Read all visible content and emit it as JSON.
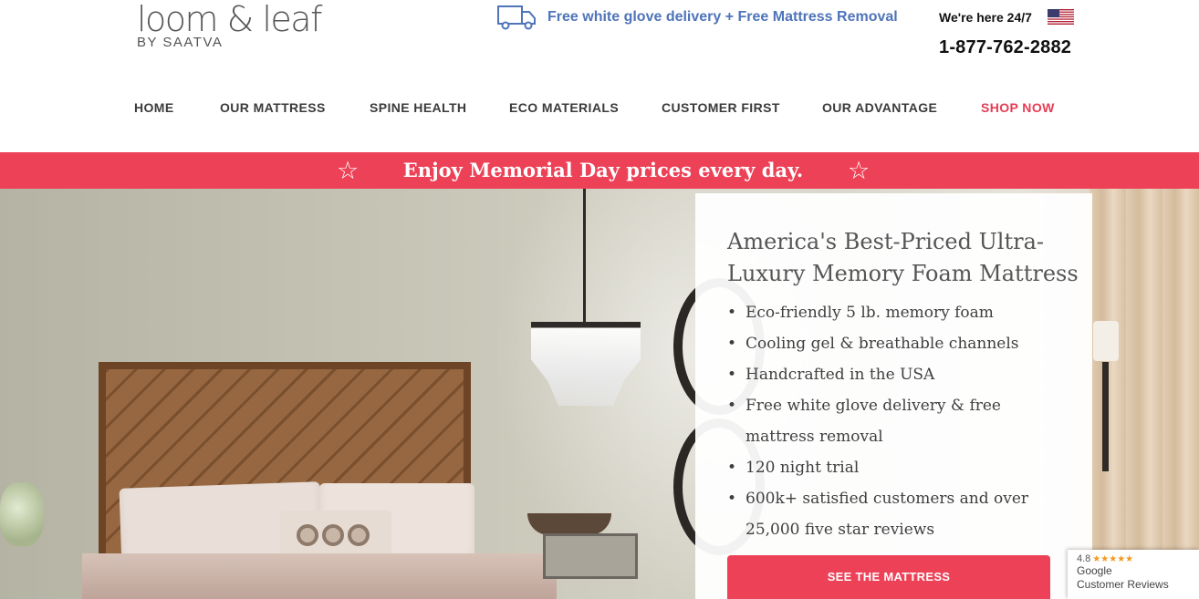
{
  "header": {
    "logo_main": "loom & leaf",
    "logo_sub": "BY SAATVA",
    "delivery_text": "Free white glove delivery + Free Mattress Removal",
    "support_text": "We're here 24/7",
    "phone": "1-877-762-2882",
    "truck_icon": "truck-icon",
    "flag_icon": "us-flag-icon"
  },
  "nav": {
    "items": [
      {
        "label": "HOME"
      },
      {
        "label": "OUR MATTRESS"
      },
      {
        "label": "SPINE HEALTH"
      },
      {
        "label": "ECO MATERIALS"
      },
      {
        "label": "CUSTOMER FIRST"
      },
      {
        "label": "OUR ADVANTAGE"
      },
      {
        "label": "SHOP NOW"
      }
    ]
  },
  "promo": {
    "text": "Enjoy Memorial Day prices every day.",
    "icon": "star-icon"
  },
  "hero_card": {
    "title": "America's Best-Priced Ultra-Luxury Memory Foam Mattress",
    "features": [
      "Eco-friendly 5 lb. memory foam",
      "Cooling gel & breathable channels",
      "Handcrafted in the USA",
      "Free white glove delivery & free mattress removal",
      "120 night trial",
      "600k+ satisfied customers and over 25,000 five star reviews"
    ],
    "cta_label": "SEE THE MATTRESS"
  },
  "reviews_badge": {
    "rating": "4.8",
    "stars": "★★★★★",
    "line1": "Google",
    "line2": "Customer Reviews"
  },
  "colors": {
    "accent_red": "#ec4157",
    "delivery_blue": "#4f74b9",
    "nav_text": "#3b3b3b"
  }
}
